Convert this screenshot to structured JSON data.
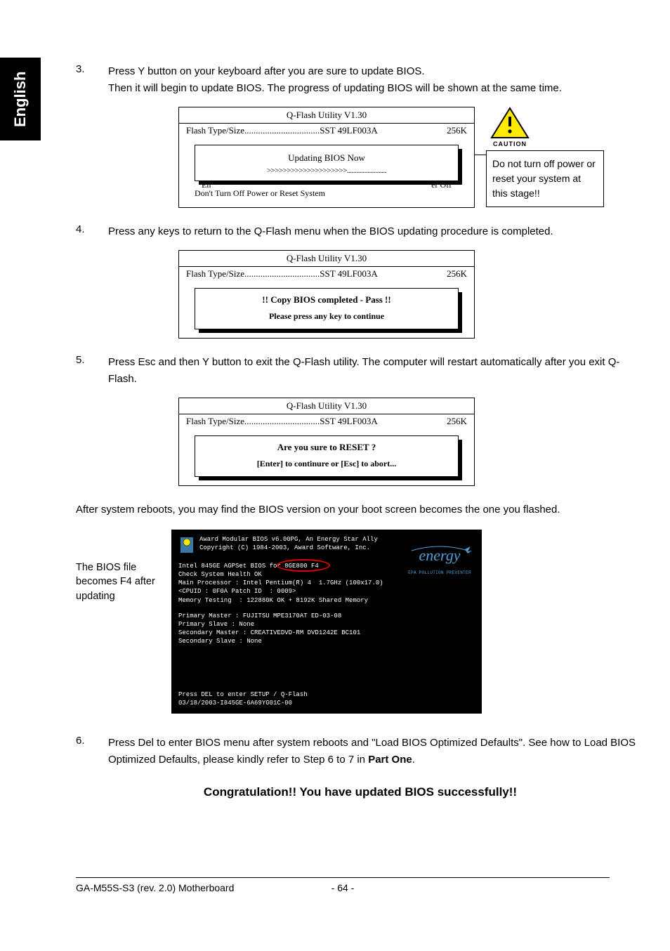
{
  "sidebar": {
    "label": "English"
  },
  "steps": {
    "s3": {
      "num": "3.",
      "line1": "Press Y button on your keyboard after you are sure to update BIOS.",
      "line2": "Then it will begin to update BIOS. The progress of updating BIOS will be shown at the same time."
    },
    "s4": {
      "num": "4.",
      "text": "Press any keys to return to the Q-Flash menu when the BIOS updating procedure is completed."
    },
    "s5": {
      "num": "5.",
      "text": "Press Esc and then Y button to exit the Q-Flash utility. The computer will restart automatically after you exit Q-Flash."
    },
    "s6": {
      "num": "6.",
      "text_part1": "Press Del to enter BIOS menu after system reboots and \"Load BIOS Optimized Defaults\". See how to Load BIOS Optimized Defaults, please kindly refer to Step 6 to 7 in ",
      "text_bold": "Part One",
      "text_part2": "."
    }
  },
  "qflash": {
    "title": "Q-Flash Utility V1.30",
    "flash_label": "Flash Type/Size.................................SST 49LF003A",
    "flash_size": "256K",
    "bg_left": "En",
    "bg_right": "er Off"
  },
  "dialog1": {
    "title": "Updating BIOS Now",
    "progress": ">>>>>>>>>>>>>>>>>>>>.........................",
    "footer": "Don't Turn Off Power or Reset System"
  },
  "dialog2": {
    "line1": "!! Copy BIOS completed - Pass !!",
    "line2": "Please press any key to continue"
  },
  "dialog3": {
    "line1": "Are you sure to RESET ?",
    "line2": "[Enter] to continure or [Esc] to abort..."
  },
  "caution": {
    "label": "CAUTION",
    "note": "Do not turn off power or reset your system at this stage!!"
  },
  "afterReboot": "After system reboots, you may find the BIOS version on your boot screen becomes the one you flashed.",
  "postSideLabel": "The BIOS file becomes F4 after updating",
  "post": {
    "header1": "Award Modular BIOS v6.00PG, An Energy Star Ally",
    "header2": "Copyright (C) 1984-2003, Award Software, Inc.",
    "l1a": "Intel 845GE AGPSet BIOS ",
    "l1b": "for 8GE800 F4",
    "l2": "Check System Health OK",
    "l3": "Main Processor : Intel Pentium(R) 4  1.7GHz (100x17.0)",
    "l4": "<CPUID : 0F0A Patch ID  : 0009>",
    "l5": "Memory Testing  : 122880K OK + 8192K Shared Memory",
    "d1": "Primary Master : FUJITSU MPE3170AT ED-03-08",
    "d2": "Primary Slave : None",
    "d3": "Secondary Master : CREATIVEDVD-RM DVD1242E BC101",
    "d4": "Secondary Slave : None",
    "foot1": "Press DEL to enter SETUP / Q-Flash",
    "foot2": "03/18/2003-I845GE-6A69YG01C-00",
    "energySub": "EPA  POLLUTION PREVENTER"
  },
  "congrats": "Congratulation!! You have updated BIOS successfully!!",
  "footer": {
    "model": "GA-M55S-S3 (rev. 2.0) Motherboard",
    "page": "- 64 -"
  }
}
